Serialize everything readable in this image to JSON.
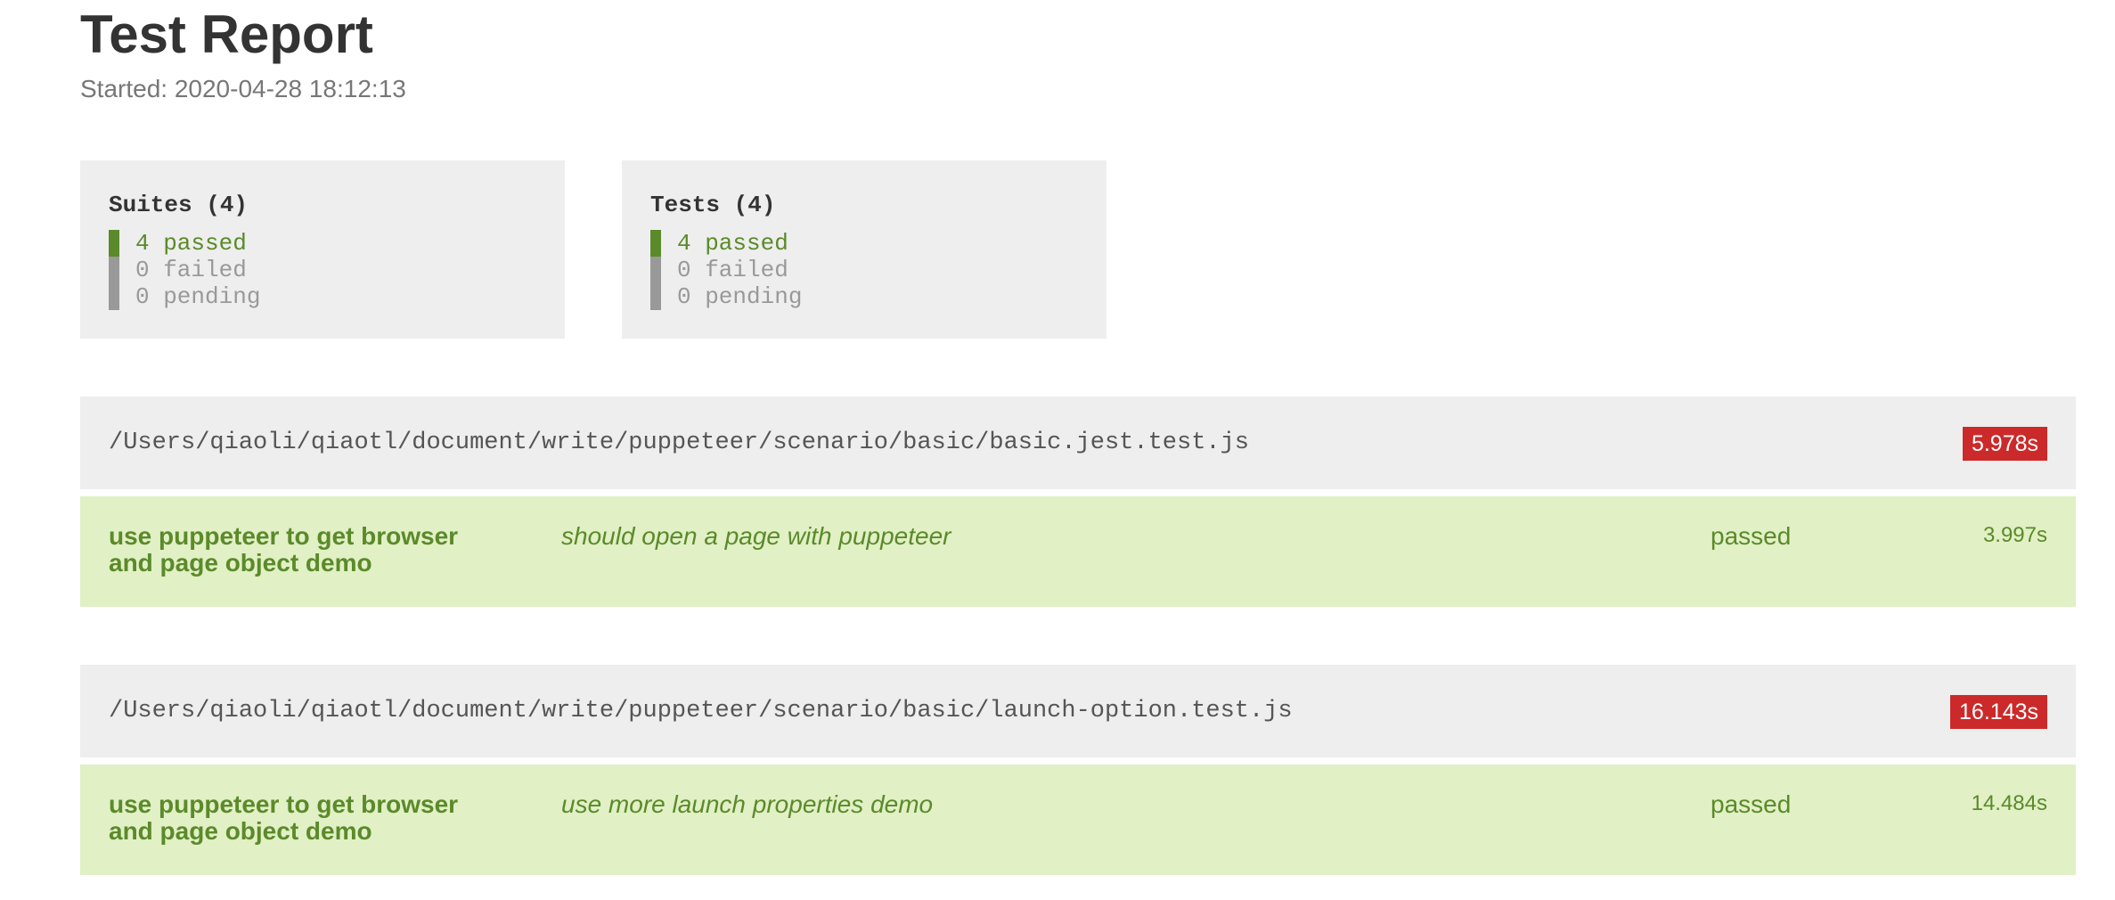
{
  "header": {
    "title": "Test Report",
    "started": "Started: 2020-04-28 18:12:13"
  },
  "summary": {
    "suites": {
      "title": "Suites (4)",
      "passed": "4 passed",
      "failed": "0 failed",
      "pending": "0 pending"
    },
    "tests": {
      "title": "Tests (4)",
      "passed": "4 passed",
      "failed": "0 failed",
      "pending": "0 pending"
    }
  },
  "suites": [
    {
      "path": "/Users/qiaoli/qiaotl/document/write/puppeteer/scenario/basic/basic.jest.test.js",
      "time": "5.978s",
      "tests": [
        {
          "suite_name": "use puppeteer to get browser and page object demo",
          "title": "should open a page with puppeteer",
          "status": "passed",
          "duration": "3.997s"
        }
      ]
    },
    {
      "path": "/Users/qiaoli/qiaotl/document/write/puppeteer/scenario/basic/launch-option.test.js",
      "time": "16.143s",
      "tests": [
        {
          "suite_name": "use puppeteer to get browser and page object demo",
          "title": "use more launch properties demo",
          "status": "passed",
          "duration": "14.484s"
        }
      ]
    }
  ],
  "colors": {
    "passed": "#5b8a2a",
    "passed_bg": "#e1f0c5",
    "muted": "#999999",
    "time_badge": "#cc2a2a",
    "panel_bg": "#eeeeee"
  }
}
